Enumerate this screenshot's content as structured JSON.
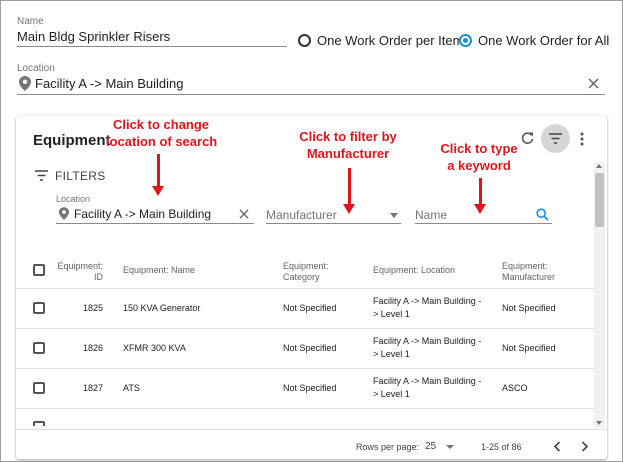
{
  "form": {
    "name_label": "Name",
    "name_value": "Main Bldg Sprinkler Risers",
    "radio_options": [
      {
        "label": "One Work Order per Item",
        "selected": false
      },
      {
        "label": "One Work Order for All",
        "selected": true
      }
    ],
    "location_label": "Location",
    "location_value": "Facility A -> Main Building"
  },
  "equipment": {
    "title": "Equipment",
    "filters_label": "FILTERS",
    "filter_location_label": "Location",
    "filter_location_value": "Facility A -> Main Building",
    "filter_manufacturer_placeholder": "Manufacturer",
    "filter_name_placeholder": "Name",
    "columns": [
      {
        "line1": "Equipment:",
        "line2": "ID"
      },
      {
        "line1": "Equipment: Name",
        "line2": ""
      },
      {
        "line1": "Equipment:",
        "line2": "Category"
      },
      {
        "line1": "Equipment: Location",
        "line2": ""
      },
      {
        "line1": "Equipment:",
        "line2": "Manufacturer"
      }
    ],
    "rows": [
      {
        "id": "1825",
        "name": "150 KVA Generator",
        "category": "Not Specified",
        "location_1": "Facility A -> Main Building -",
        "location_2": "> Level 1",
        "manufacturer": "Not Specified"
      },
      {
        "id": "1826",
        "name": "XFMR 300 KVA",
        "category": "Not Specified",
        "location_1": "Facility A -> Main Building -",
        "location_2": "> Level 1",
        "manufacturer": "Not Specified"
      },
      {
        "id": "1827",
        "name": "ATS",
        "category": "Not Specified",
        "location_1": "Facility A -> Main Building -",
        "location_2": "> Level 1",
        "manufacturer": "ASCO"
      }
    ],
    "pagination": {
      "rows_per_page_label": "Rows per page:",
      "rows_per_page_value": "25",
      "range": "1-25 of 86"
    }
  },
  "annotations": [
    {
      "line1": "Click to change",
      "line2": "location of search"
    },
    {
      "line1": "Click to filter by",
      "line2": "Manufacturer"
    },
    {
      "line1": "Click to type",
      "line2": "a keyword"
    }
  ],
  "colors": {
    "accent": "#1a8fd8",
    "annotation": "#e0151b"
  }
}
